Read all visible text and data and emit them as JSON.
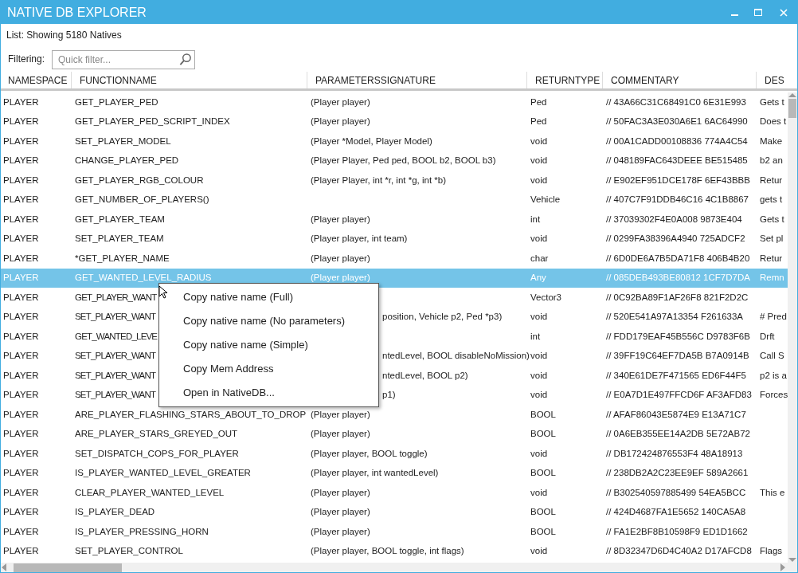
{
  "window": {
    "title": "NATIVE DB EXPLORER"
  },
  "status": "List: Showing 5180 Natives",
  "filter": {
    "label": "Filtering:",
    "placeholder": "Quick filter..."
  },
  "table": {
    "columns": [
      "NAMESPACE",
      "FUNCTIONNAME",
      "PARAMETERSSIGNATURE",
      "RETURNTYPE",
      "COMMENTARY",
      "DES"
    ],
    "rows": [
      {
        "selected": false,
        "under_menu": false,
        "namespace": "PLAYER",
        "function_name": "GET_PLAYER_PED",
        "parameters": "(Player player)",
        "return_type": "Ped",
        "commentary": "// 43A66C31C68491C0 6E31E993",
        "description": "Gets t"
      },
      {
        "selected": false,
        "under_menu": false,
        "namespace": "PLAYER",
        "function_name": "GET_PLAYER_PED_SCRIPT_INDEX",
        "parameters": "(Player player)",
        "return_type": "Ped",
        "commentary": "// 50FAC3A3E030A6E1 6AC64990",
        "description": "Does t"
      },
      {
        "selected": false,
        "under_menu": false,
        "namespace": "PLAYER",
        "function_name": "SET_PLAYER_MODEL",
        "parameters": "(Player *Model, Player Model)",
        "return_type": "void",
        "commentary": "// 00A1CADD00108836 774A4C54",
        "description": "Make"
      },
      {
        "selected": false,
        "under_menu": false,
        "namespace": "PLAYER",
        "function_name": "CHANGE_PLAYER_PED",
        "parameters": "(Player Player, Ped ped, BOOL b2, BOOL b3)",
        "return_type": "void",
        "commentary": "// 048189FAC643DEEE BE515485",
        "description": "b2 an"
      },
      {
        "selected": false,
        "under_menu": false,
        "namespace": "PLAYER",
        "function_name": "GET_PLAYER_RGB_COLOUR",
        "parameters": "(Player Player, int *r, int *g, int *b)",
        "return_type": "void",
        "commentary": "// E902EF951DCE178F 6EF43BBB",
        "description": "Retur"
      },
      {
        "selected": false,
        "under_menu": false,
        "namespace": "PLAYER",
        "function_name": "GET_NUMBER_OF_PLAYERS()",
        "return_type": "Vehicle",
        "commentary": "// 407C7F91DDB46C16 4C1B8867",
        "description": "gets t"
      },
      {
        "selected": false,
        "under_menu": false,
        "namespace": "PLAYER",
        "function_name": "GET_PLAYER_TEAM",
        "parameters": "(Player player)",
        "return_type": "int",
        "commentary": "// 37039302F4E0A008 9873E404",
        "description": "Gets t"
      },
      {
        "selected": false,
        "under_menu": false,
        "namespace": "PLAYER",
        "function_name": "SET_PLAYER_TEAM",
        "parameters": "(Player player, int team)",
        "return_type": "void",
        "commentary": "// 0299FA38396A4940 725ADCF2",
        "description": "Set pl"
      },
      {
        "selected": false,
        "under_menu": false,
        "namespace": "PLAYER",
        "function_name": "*GET_PLAYER_NAME",
        "parameters": "(Player player)",
        "return_type": "char",
        "commentary": "// 6D0DE6A7B5DA71F8 406B4B20",
        "description": "Retur"
      },
      {
        "selected": true,
        "under_menu": false,
        "namespace": "PLAYER",
        "function_name": "GET_WANTED_LEVEL_RADIUS",
        "parameters": "(Player player)",
        "return_type": "Any",
        "commentary": "// 085DEB493BE80812 1CF7D7DA",
        "description": "Remn"
      },
      {
        "selected": false,
        "under_menu": true,
        "namespace": "PLAYER",
        "function_name": "GET_PLAYER_WANT",
        "return_type": "Vector3",
        "commentary": "// 0C92BA89F1AF26F8 821F2D2C"
      },
      {
        "selected": false,
        "under_menu": true,
        "namespace": "PLAYER",
        "function_name": "SET_PLAYER_WANT",
        "parameters": "position, Vehicle p2, Ped *p3)",
        "return_type": "void",
        "commentary": "// 520E541A97A13354 F261633A",
        "description": "# Pred"
      },
      {
        "selected": false,
        "under_menu": true,
        "namespace": "PLAYER",
        "function_name": "GET_WANTED_LEVE",
        "return_type": "int",
        "commentary": "// FDD179EAF45B556C D9783F6B",
        "description": "Drft"
      },
      {
        "selected": false,
        "under_menu": true,
        "namespace": "PLAYER",
        "function_name": "SET_PLAYER_WANT",
        "parameters": "ntedLevel, BOOL disableNoMission)",
        "return_type": "void",
        "commentary": "// 39FF19C64EF7DA5B B7A0914B",
        "description": "Call S"
      },
      {
        "selected": false,
        "under_menu": true,
        "namespace": "PLAYER",
        "function_name": "SET_PLAYER_WANT",
        "parameters": "ntedLevel, BOOL p2)",
        "return_type": "void",
        "commentary": "// 340E61DE7F471565 ED6F44F5",
        "description": "p2 is a"
      },
      {
        "selected": false,
        "under_menu": true,
        "namespace": "PLAYER",
        "function_name": "SET_PLAYER_WANT",
        "parameters": "p1)",
        "return_type": "void",
        "commentary": "// E0A7D1E497FFCD6F AF3AFD83",
        "description": "Forces"
      },
      {
        "selected": false,
        "under_menu": false,
        "namespace": "PLAYER",
        "function_name": "ARE_PLAYER_FLASHING_STARS_ABOUT_TO_DROP",
        "parameters": "(Player player)",
        "return_type": "BOOL",
        "commentary": "// AFAF86043E5874E9 E13A71C7"
      },
      {
        "selected": false,
        "under_menu": false,
        "namespace": "PLAYER",
        "function_name": "ARE_PLAYER_STARS_GREYED_OUT",
        "parameters": "(Player player)",
        "return_type": "BOOL",
        "commentary": "// 0A6EB355EE14A2DB 5E72AB72"
      },
      {
        "selected": false,
        "under_menu": false,
        "namespace": "PLAYER",
        "function_name": "SET_DISPATCH_COPS_FOR_PLAYER",
        "parameters": "(Player player, BOOL toggle)",
        "return_type": "void",
        "commentary": "// DB172424876553F4 48A18913"
      },
      {
        "selected": false,
        "under_menu": false,
        "namespace": "PLAYER",
        "function_name": "IS_PLAYER_WANTED_LEVEL_GREATER",
        "parameters": "(Player player, int wantedLevel)",
        "return_type": "BOOL",
        "commentary": "// 238DB2A2C23EE9EF 589A2661"
      },
      {
        "selected": false,
        "under_menu": false,
        "namespace": "PLAYER",
        "function_name": "CLEAR_PLAYER_WANTED_LEVEL",
        "parameters": "(Player player)",
        "return_type": "void",
        "commentary": "// B302540597885499 54EA5BCC",
        "description": "This e"
      },
      {
        "selected": false,
        "under_menu": false,
        "namespace": "PLAYER",
        "function_name": "IS_PLAYER_DEAD",
        "parameters": "(Player player)",
        "return_type": "BOOL",
        "commentary": "// 424D4687FA1E5652 140CA5A8"
      },
      {
        "selected": false,
        "under_menu": false,
        "namespace": "PLAYER",
        "function_name": "IS_PLAYER_PRESSING_HORN",
        "parameters": "(Player player)",
        "return_type": "BOOL",
        "commentary": "// FA1E2BF8B10598F9 ED1D1662"
      },
      {
        "selected": false,
        "under_menu": false,
        "namespace": "PLAYER",
        "function_name": "SET_PLAYER_CONTROL",
        "parameters": "(Player player, BOOL toggle, int flags)",
        "return_type": "void",
        "commentary": "// 8D32347D6D4C40A2 D17AFCD8",
        "description": "Flags"
      }
    ]
  },
  "context_menu": {
    "items": [
      "Copy native name (Full)",
      "Copy native name (No parameters)",
      "Copy native name (Simple)",
      "Copy Mem Address",
      "Open in NativeDB..."
    ]
  }
}
